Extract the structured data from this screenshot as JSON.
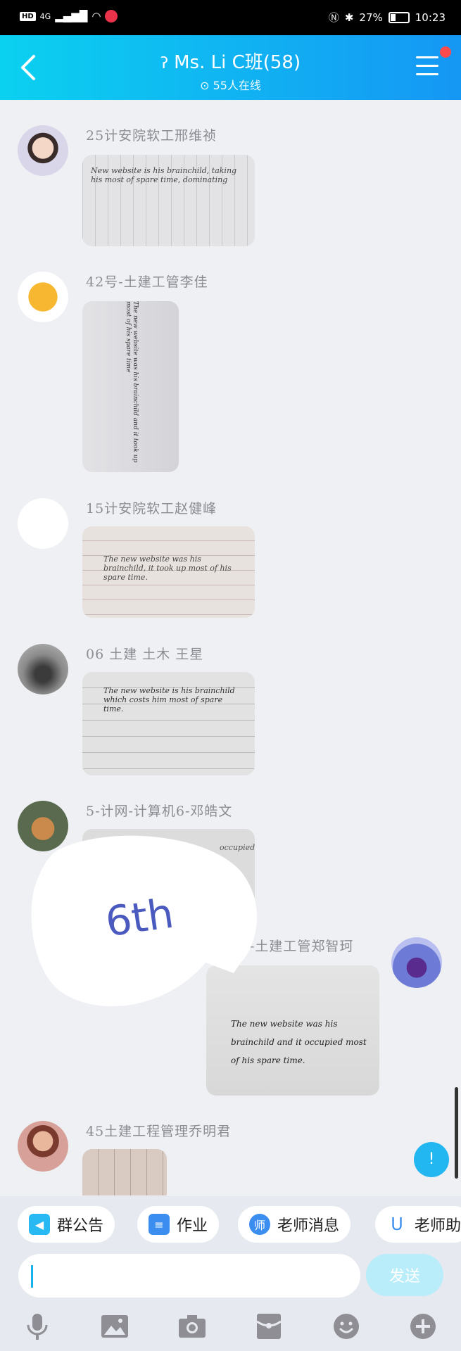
{
  "status_bar": {
    "network": "HD",
    "signal": "4G",
    "battery": "27%",
    "time": "10:23"
  },
  "header": {
    "title": "Ms. Li C班(58)",
    "online": "55人在线"
  },
  "messages": [
    {
      "sender": "25计安院软工邢维祯",
      "side": "left",
      "photo_text": "New website is his brainchild, taking his most of spare time, dominating"
    },
    {
      "sender": "42号-土建工管李佳",
      "side": "left",
      "photo_text": "The new website was his brainchild and it took up most of his spare time"
    },
    {
      "sender": "15计安院软工赵健峰",
      "side": "left",
      "photo_text": "The new website was his brainchild, it took up most of his spare time."
    },
    {
      "sender": "06 土建 土木 王星",
      "side": "left",
      "photo_text": "The new website is his brainchild which costs him most of spare time."
    },
    {
      "sender": "5-计网-计算机6-邓皓文",
      "side": "left",
      "photo_text": "occupied"
    },
    {
      "sender": "-土建工管郑智珂",
      "side": "right",
      "photo_text": "The new website was his brainchild and it occupied most of his spare time."
    },
    {
      "sender": "45土建工程管理乔明君",
      "side": "left",
      "photo_text": ""
    }
  ],
  "overlay_bubble": {
    "text": "6th"
  },
  "float_button": {
    "label": "!"
  },
  "quick_actions": [
    {
      "label": "群公告",
      "icon": "megaphone-icon"
    },
    {
      "label": "作业",
      "icon": "homework-icon"
    },
    {
      "label": "老师消息",
      "icon": "teacher-icon"
    },
    {
      "label": "老师助",
      "icon": "assistant-icon"
    }
  ],
  "input": {
    "value": "",
    "placeholder": ""
  },
  "send_label": "发送",
  "toolbar_icons": [
    "microphone-icon",
    "image-icon",
    "camera-icon",
    "red-packet-icon",
    "emoji-icon",
    "plus-icon"
  ],
  "colors": {
    "header_start": "#0bd1f0",
    "header_end": "#1597f4",
    "accent": "#18b3ee"
  }
}
